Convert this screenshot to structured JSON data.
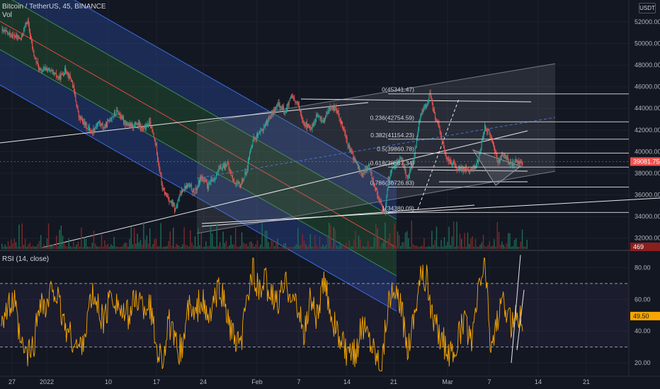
{
  "header": {
    "symbol": "Bitcoin / TetherUS, 45, BINANCE",
    "vol_label": "Vol",
    "rsi_label": "RSI (14, close)",
    "currency_button": "USDT"
  },
  "colors": {
    "background": "#131722",
    "candle_up": "#26a69a",
    "candle_down": "#ef5350",
    "rsi_line": "#f7a600",
    "price_tag": "#f05350",
    "rsi_tag": "#f7a600",
    "vol_tag": "#8a1f1f",
    "regression_blue": "#2a4fb0",
    "regression_green": "#2b6a3a",
    "regression_center": "#e2493d"
  },
  "chart_data": [
    {
      "type": "candlestick",
      "title": "Bitcoin / TetherUS, 45, BINANCE",
      "y_ticks": [
        52000,
        50000,
        48000,
        46000,
        44000,
        42000,
        40000,
        38000,
        36000,
        34000,
        32000
      ],
      "y_tick_labels": [
        "52000.00",
        "50000.00",
        "48000.00",
        "46000.00",
        "44000.00",
        "42000.00",
        "40000.00",
        "38000.00",
        "36000.00",
        "34000.00",
        "32000.00"
      ],
      "ylim": [
        31000,
        53500
      ],
      "x_tick_labels": [
        "27",
        "2022",
        "10",
        "17",
        "24",
        "Feb",
        "7",
        "14",
        "21",
        "Mar",
        "7",
        "14",
        "21"
      ],
      "last_price": "39081.75",
      "last_volume": "469",
      "price_path": [
        [
          0,
          51200
        ],
        [
          3,
          50400
        ],
        [
          4,
          52200
        ],
        [
          5,
          49000
        ],
        [
          6,
          47400
        ],
        [
          7,
          47700
        ],
        [
          8,
          47200
        ],
        [
          9,
          46800
        ],
        [
          10,
          47600
        ],
        [
          11,
          46400
        ],
        [
          12,
          43200
        ],
        [
          13,
          42500
        ],
        [
          14,
          41800
        ],
        [
          15,
          42700
        ],
        [
          16,
          42200
        ],
        [
          17,
          43200
        ],
        [
          18,
          43700
        ],
        [
          19,
          42800
        ],
        [
          20,
          42300
        ],
        [
          21,
          42600
        ],
        [
          22,
          42000
        ],
        [
          23,
          42700
        ],
        [
          24,
          40500
        ],
        [
          25,
          36500
        ],
        [
          26,
          35600
        ],
        [
          27,
          34600
        ],
        [
          28,
          36500
        ],
        [
          29,
          36900
        ],
        [
          30,
          36200
        ],
        [
          31,
          37700
        ],
        [
          32,
          36800
        ],
        [
          33,
          37500
        ],
        [
          34,
          38500
        ],
        [
          35,
          38900
        ],
        [
          36,
          37300
        ],
        [
          37,
          36800
        ],
        [
          38,
          38200
        ],
        [
          39,
          41200
        ],
        [
          40,
          41500
        ],
        [
          41,
          42600
        ],
        [
          42,
          43500
        ],
        [
          43,
          44400
        ],
        [
          44,
          43700
        ],
        [
          45,
          45000
        ],
        [
          46,
          44300
        ],
        [
          47,
          42600
        ],
        [
          48,
          42100
        ],
        [
          49,
          43300
        ],
        [
          50,
          42800
        ],
        [
          51,
          44100
        ],
        [
          52,
          43900
        ],
        [
          53,
          42300
        ],
        [
          54,
          40200
        ],
        [
          55,
          39000
        ],
        [
          56,
          37800
        ],
        [
          57,
          38700
        ],
        [
          58,
          36700
        ],
        [
          59,
          34900
        ],
        [
          59.5,
          34380
        ],
        [
          60,
          37400
        ],
        [
          61,
          38800
        ],
        [
          62,
          39400
        ],
        [
          63,
          37600
        ],
        [
          64,
          39300
        ],
        [
          65,
          43400
        ],
        [
          66,
          44400
        ],
        [
          66.5,
          45341
        ],
        [
          67,
          43800
        ],
        [
          68,
          42000
        ],
        [
          69,
          39400
        ],
        [
          70,
          38900
        ],
        [
          71,
          38300
        ],
        [
          72,
          38500
        ],
        [
          73,
          38200
        ],
        [
          74,
          39200
        ],
        [
          75,
          42400
        ],
        [
          76,
          41300
        ],
        [
          77,
          39100
        ],
        [
          78,
          39700
        ],
        [
          79,
          38800
        ],
        [
          80,
          39100
        ],
        [
          81,
          39080
        ]
      ],
      "fibonacci": [
        {
          "ratio": "0",
          "price": 45341.47,
          "label": "0(45341.47)"
        },
        {
          "ratio": "0.236",
          "price": 42754.59,
          "label": "0.236(42754.59)"
        },
        {
          "ratio": "0.382",
          "price": 41154.23,
          "label": "0.382(41154.23)"
        },
        {
          "ratio": "0.5",
          "price": 39860.78,
          "label": "0.5(39860.78)"
        },
        {
          "ratio": "0.618",
          "price": 38567.34,
          "label": "0.618(38567.34)"
        },
        {
          "ratio": "0.786",
          "price": 36726.83,
          "label": "0.786(36726.83)"
        },
        {
          "ratio": "1",
          "price": 34380.09,
          "label": "1(34380.09)"
        }
      ]
    },
    {
      "type": "line",
      "title": "RSI (14, close)",
      "y_ticks": [
        80,
        60,
        40,
        20
      ],
      "y_tick_labels": [
        "80.00",
        "60.00",
        "40.00",
        "20.00"
      ],
      "ylim": [
        12,
        90
      ],
      "bands": [
        70,
        30
      ],
      "last_value": "49.50",
      "rsi_path": [
        [
          0,
          50
        ],
        [
          2,
          58
        ],
        [
          3,
          30
        ],
        [
          4,
          25
        ],
        [
          5,
          30
        ],
        [
          6,
          62
        ],
        [
          7,
          52
        ],
        [
          8,
          70
        ],
        [
          9,
          55
        ],
        [
          10,
          42
        ],
        [
          11,
          35
        ],
        [
          12,
          28
        ],
        [
          13,
          40
        ],
        [
          14,
          62
        ],
        [
          15,
          55
        ],
        [
          16,
          45
        ],
        [
          17,
          65
        ],
        [
          18,
          58
        ],
        [
          19,
          48
        ],
        [
          20,
          52
        ],
        [
          21,
          62
        ],
        [
          22,
          55
        ],
        [
          23,
          58
        ],
        [
          24,
          32
        ],
        [
          25,
          22
        ],
        [
          26,
          45
        ],
        [
          27,
          30
        ],
        [
          28,
          28
        ],
        [
          29,
          55
        ],
        [
          30,
          48
        ],
        [
          31,
          62
        ],
        [
          32,
          45
        ],
        [
          33,
          58
        ],
        [
          34,
          68
        ],
        [
          35,
          50
        ],
        [
          36,
          35
        ],
        [
          37,
          28
        ],
        [
          38,
          55
        ],
        [
          39,
          82
        ],
        [
          40,
          62
        ],
        [
          41,
          72
        ],
        [
          42,
          60
        ],
        [
          43,
          58
        ],
        [
          44,
          70
        ],
        [
          45,
          66
        ],
        [
          46,
          52
        ],
        [
          47,
          38
        ],
        [
          48,
          62
        ],
        [
          49,
          48
        ],
        [
          50,
          70
        ],
        [
          51,
          55
        ],
        [
          52,
          40
        ],
        [
          53,
          30
        ],
        [
          54,
          22
        ],
        [
          55,
          28
        ],
        [
          56,
          45
        ],
        [
          57,
          38
        ],
        [
          58,
          28
        ],
        [
          59,
          18
        ],
        [
          60,
          60
        ],
        [
          61,
          62
        ],
        [
          62,
          56
        ],
        [
          63,
          30
        ],
        [
          64,
          50
        ],
        [
          65,
          76
        ],
        [
          66,
          72
        ],
        [
          67,
          46
        ],
        [
          68,
          38
        ],
        [
          69,
          30
        ],
        [
          70,
          22
        ],
        [
          71,
          38
        ],
        [
          72,
          46
        ],
        [
          73,
          30
        ],
        [
          74,
          66
        ],
        [
          75,
          84
        ],
        [
          76,
          28
        ],
        [
          77,
          50
        ],
        [
          78,
          56
        ],
        [
          79,
          44
        ],
        [
          80,
          52
        ],
        [
          81,
          49.5
        ]
      ]
    }
  ]
}
